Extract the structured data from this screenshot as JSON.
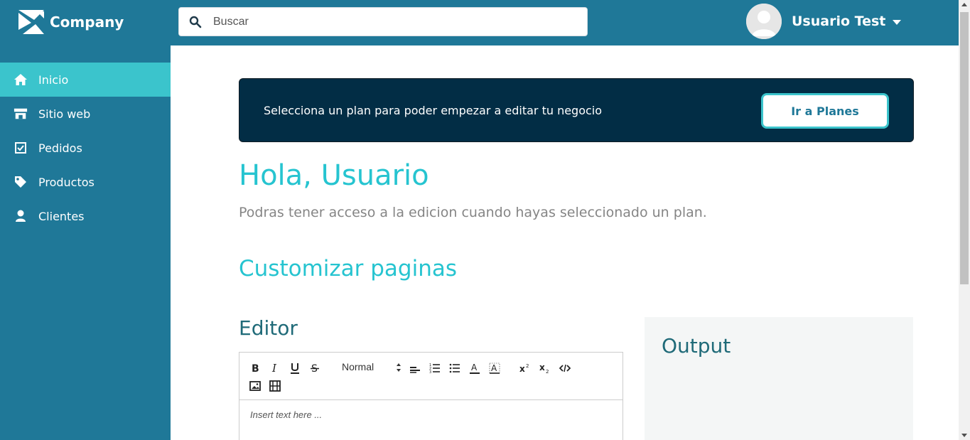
{
  "brand": {
    "name": "Company"
  },
  "search": {
    "placeholder": "Buscar"
  },
  "user": {
    "name": "Usuario Test"
  },
  "sidebar": {
    "items": [
      {
        "label": "Inicio",
        "icon": "home-icon",
        "active": true
      },
      {
        "label": "Sitio web",
        "icon": "store-icon",
        "active": false
      },
      {
        "label": "Pedidos",
        "icon": "checkbox-icon",
        "active": false
      },
      {
        "label": "Productos",
        "icon": "tag-icon",
        "active": false
      },
      {
        "label": "Clientes",
        "icon": "user-icon",
        "active": false
      }
    ]
  },
  "banner": {
    "text": "Selecciona un plan para poder empezar a editar tu negocio",
    "button_label": "Ir a Planes"
  },
  "main": {
    "greeting": "Hola, Usuario",
    "subtext": "Podras tener acceso a la edicion cuando hayas seleccionado un plan.",
    "section_title": "Customizar paginas"
  },
  "editor": {
    "title": "Editor",
    "format_select": "Normal",
    "placeholder": "Insert text here ..."
  },
  "output": {
    "title": "Output"
  },
  "colors": {
    "topbar": "#1f7898",
    "sidebar": "#1f7898",
    "sidebar_active": "#3bc4cc",
    "banner": "#022d45",
    "accent": "#26c4d0",
    "heading_dark": "#1f6a78"
  }
}
